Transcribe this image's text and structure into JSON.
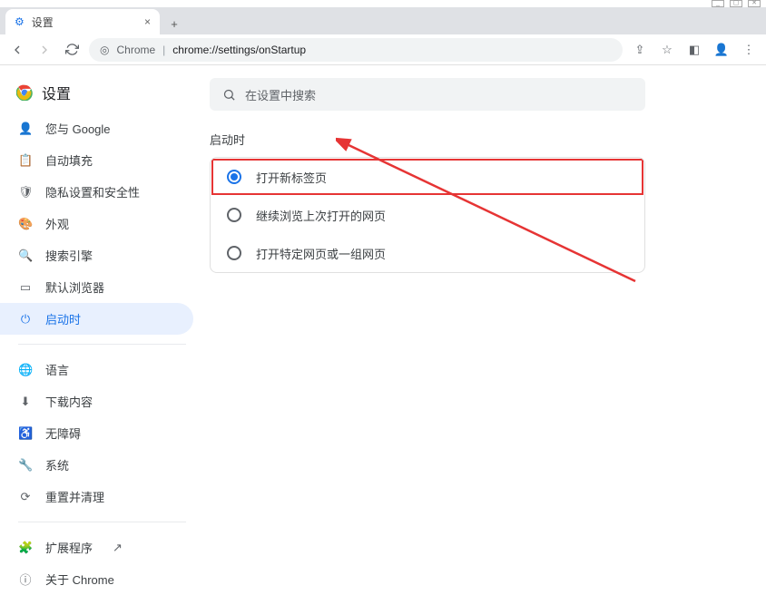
{
  "os": {
    "min": "_",
    "max": "▢",
    "close": "✕"
  },
  "tabstrip": {
    "tab_title": "设置",
    "close": "×",
    "plus": "+"
  },
  "toolbar": {
    "url_origin": "Chrome",
    "url_path": "chrome://settings/onStartup"
  },
  "sidebar": {
    "app_title": "设置",
    "items_a": [
      {
        "icon": "👤",
        "label": "您与 Google"
      },
      {
        "icon": "📋",
        "label": "自动填充"
      },
      {
        "icon": "🛡",
        "label": "隐私设置和安全性"
      },
      {
        "icon": "🎨",
        "label": "外观"
      },
      {
        "icon": "🔍",
        "label": "搜索引擎"
      },
      {
        "icon": "▭",
        "label": "默认浏览器"
      },
      {
        "icon": "⏻",
        "label": "启动时"
      }
    ],
    "items_b": [
      {
        "icon": "🌐",
        "label": "语言"
      },
      {
        "icon": "⬇",
        "label": "下载内容"
      },
      {
        "icon": "♿",
        "label": "无障碍"
      },
      {
        "icon": "🔧",
        "label": "系统"
      },
      {
        "icon": "⟳",
        "label": "重置并清理"
      }
    ],
    "items_c": [
      {
        "icon": "🧩",
        "label": "扩展程序",
        "ext": "↗"
      },
      {
        "icon": "ⓘ",
        "label": "关于 Chrome"
      }
    ]
  },
  "main": {
    "search_placeholder": "在设置中搜索",
    "section_title": "启动时",
    "options": [
      {
        "label": "打开新标签页",
        "checked": true
      },
      {
        "label": "继续浏览上次打开的网页",
        "checked": false
      },
      {
        "label": "打开特定网页或一组网页",
        "checked": false
      }
    ]
  }
}
